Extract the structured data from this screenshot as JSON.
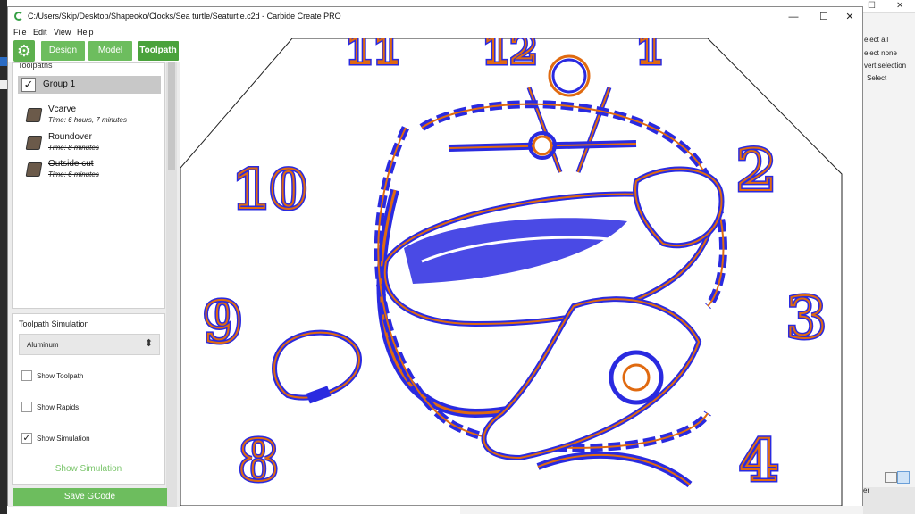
{
  "window": {
    "title": "C:/Users/Skip/Desktop/Shapeoko/Clocks/Sea turtle/Seaturtle.c2d - Carbide Create PRO",
    "minimize_glyph": "—",
    "maximize_glyph": "☐",
    "close_glyph": "✕"
  },
  "menu": [
    "File",
    "Edit",
    "View",
    "Help"
  ],
  "toolbar": {
    "settings_icon": "gear-icon",
    "tabs": [
      "Design",
      "Model",
      "Toolpath"
    ],
    "active_tab": "Toolpath"
  },
  "toolpaths": {
    "header": "Toolpaths",
    "group": {
      "label": "Group 1",
      "checked": true
    },
    "items": [
      {
        "name": "Vcarve",
        "time": "Time: 6 hours, 7 minutes",
        "disabled": false
      },
      {
        "name": "Roundover",
        "time": "Time: 8 minutes",
        "disabled": true
      },
      {
        "name": "Outside cut",
        "time": "Time: 6 minutes",
        "disabled": true
      }
    ]
  },
  "simulation": {
    "title": "Toolpath Simulation",
    "material": "Aluminum",
    "show_toolpath": {
      "label": "Show Toolpath",
      "checked": false
    },
    "show_rapids": {
      "label": "Show Rapids",
      "checked": false
    },
    "show_simulation": {
      "label": "Show Simulation",
      "checked": true
    },
    "show_button": "Show Simulation"
  },
  "save_gcode": "Save GCode",
  "background_window": {
    "items": [
      "elect all",
      "elect none",
      "vert selection",
      "Select"
    ],
    "tail_text": "er"
  },
  "colors": {
    "accent_green": "#6dbd5e",
    "active_green": "#4aa23c",
    "toolpath_blue": "#2a2ae0",
    "toolpath_orange": "#e06a10"
  },
  "canvas": {
    "clock_numbers": [
      "11",
      "12",
      "1",
      "10",
      "2",
      "9",
      "3",
      "8",
      "4"
    ]
  }
}
